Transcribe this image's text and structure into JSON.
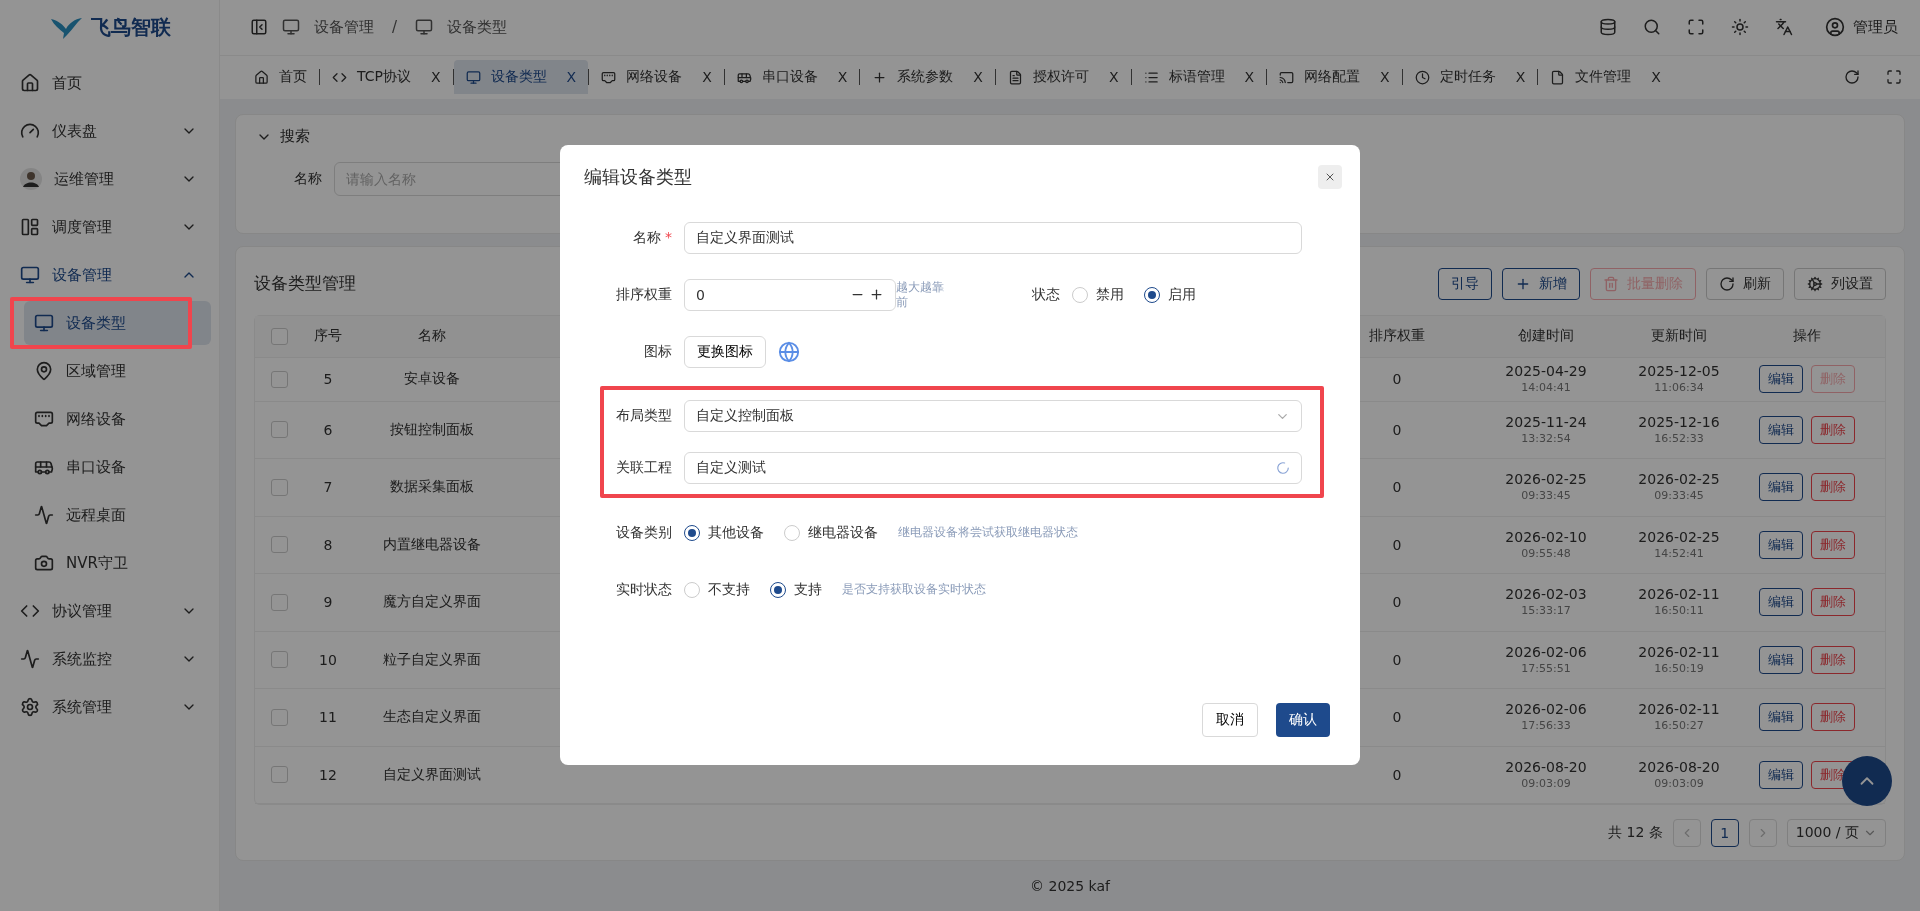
{
  "brand": {
    "name": "飞鸟智联"
  },
  "sidebar": {
    "items": [
      {
        "kind": "link",
        "label": "首页"
      },
      {
        "kind": "group",
        "label": "仪表盘",
        "expanded": false
      },
      {
        "kind": "group",
        "label": "运维管理",
        "expanded": false
      },
      {
        "kind": "group",
        "label": "调度管理",
        "expanded": false
      },
      {
        "kind": "group",
        "label": "设备管理",
        "expanded": true,
        "children": [
          {
            "label": "设备类型",
            "selected": true
          },
          {
            "label": "区域管理",
            "selected": false
          },
          {
            "label": "网络设备",
            "selected": false
          },
          {
            "label": "串口设备",
            "selected": false
          },
          {
            "label": "远程桌面",
            "selected": false
          },
          {
            "label": "NVR守卫",
            "selected": false
          }
        ]
      },
      {
        "kind": "group",
        "label": "协议管理",
        "expanded": false
      },
      {
        "kind": "group",
        "label": "系统监控",
        "expanded": false
      },
      {
        "kind": "group",
        "label": "系统管理",
        "expanded": false
      }
    ]
  },
  "header": {
    "breadcrumb": [
      "设备管理",
      "设备类型"
    ],
    "separator": "/",
    "user": "管理员"
  },
  "tabs": [
    {
      "label": "首页",
      "selected": false,
      "closable": false
    },
    {
      "label": "TCP协议",
      "selected": false,
      "closable": true,
      "close": "X"
    },
    {
      "label": "设备类型",
      "selected": true,
      "closable": true,
      "close": "X"
    },
    {
      "label": "网络设备",
      "selected": false,
      "closable": true,
      "close": "X"
    },
    {
      "label": "串口设备",
      "selected": false,
      "closable": true,
      "close": "X"
    },
    {
      "label": "系统参数",
      "selected": false,
      "closable": true,
      "close": "X"
    },
    {
      "label": "授权许可",
      "selected": false,
      "closable": true,
      "close": "X"
    },
    {
      "label": "标语管理",
      "selected": false,
      "closable": true,
      "close": "X"
    },
    {
      "label": "网络配置",
      "selected": false,
      "closable": true,
      "close": "X"
    },
    {
      "label": "定时任务",
      "selected": false,
      "closable": true,
      "close": "X"
    },
    {
      "label": "文件管理",
      "selected": false,
      "closable": true,
      "close": "X"
    }
  ],
  "search": {
    "title": "搜索",
    "expanded": true,
    "label": "名称",
    "placeholder": "请输入名称"
  },
  "table": {
    "title": "设备类型管理",
    "toolbar": [
      {
        "kind": "plain",
        "label": "引导",
        "disabled": false
      },
      {
        "kind": "add",
        "label": "新增",
        "disabled": false
      },
      {
        "kind": "delete",
        "label": "批量删除",
        "disabled": true
      },
      {
        "kind": "refresh",
        "label": "刷新",
        "disabled": false
      },
      {
        "kind": "settings",
        "label": "列设置",
        "disabled": false
      }
    ],
    "all_checked": false,
    "columns": [
      "序号",
      "名称",
      "排序权重",
      "创建时间",
      "更新时间",
      "操作"
    ],
    "rows": [
      {
        "checked": false,
        "seq": "5",
        "name": "安卓设备",
        "weight": "0",
        "created_date": "2025-04-29",
        "created_time": "14:04:41",
        "updated_date": "2025-12-05",
        "updated_time": "11:06:34",
        "edit": "编辑",
        "delete": "删除",
        "delete_disabled": true
      },
      {
        "checked": false,
        "seq": "6",
        "name": "按钮控制面板",
        "weight": "0",
        "created_date": "2025-11-24",
        "created_time": "13:32:54",
        "updated_date": "2025-12-16",
        "updated_time": "16:52:33",
        "edit": "编辑",
        "delete": "删除",
        "delete_disabled": false
      },
      {
        "checked": false,
        "seq": "7",
        "name": "数据采集面板",
        "weight": "0",
        "created_date": "2026-02-25",
        "created_time": "09:33:45",
        "updated_date": "2026-02-25",
        "updated_time": "09:33:45",
        "edit": "编辑",
        "delete": "删除",
        "delete_disabled": false
      },
      {
        "checked": false,
        "seq": "8",
        "name": "内置继电器设备",
        "weight": "0",
        "created_date": "2026-02-10",
        "created_time": "09:55:48",
        "updated_date": "2026-02-25",
        "updated_time": "14:52:41",
        "edit": "编辑",
        "delete": "删除",
        "delete_disabled": false
      },
      {
        "checked": false,
        "seq": "9",
        "name": "魔方自定义界面",
        "weight": "0",
        "created_date": "2026-02-03",
        "created_time": "15:33:17",
        "updated_date": "2026-02-11",
        "updated_time": "16:50:11",
        "edit": "编辑",
        "delete": "删除",
        "delete_disabled": false
      },
      {
        "checked": false,
        "seq": "10",
        "name": "粒子自定义界面",
        "weight": "0",
        "created_date": "2026-02-06",
        "created_time": "17:55:51",
        "updated_date": "2026-02-11",
        "updated_time": "16:50:19",
        "edit": "编辑",
        "delete": "删除",
        "delete_disabled": false
      },
      {
        "checked": false,
        "seq": "11",
        "name": "生态自定义界面",
        "weight": "0",
        "created_date": "2026-02-06",
        "created_time": "17:56:33",
        "updated_date": "2026-02-11",
        "updated_time": "16:50:27",
        "edit": "编辑",
        "delete": "删除",
        "delete_disabled": false
      },
      {
        "checked": false,
        "seq": "12",
        "name": "自定义界面测试",
        "weight": "0",
        "created_date": "2026-08-20",
        "created_time": "09:03:09",
        "updated_date": "2026-08-20",
        "updated_time": "09:03:09",
        "edit": "编辑",
        "delete": "删除",
        "delete_disabled": false
      }
    ],
    "pagination": {
      "total": "共 12 条",
      "page": "1",
      "page_size": "1000 / 页",
      "prev_disabled": true,
      "next_disabled": true
    }
  },
  "footer": "© 2025 kaf",
  "modal": {
    "title": "编辑设备类型",
    "name": {
      "label": "名称",
      "required": true,
      "required_mark": "*",
      "value": "自定义界面测试"
    },
    "weight": {
      "label": "排序权重",
      "value": "0",
      "hint": "越大越靠前"
    },
    "status": {
      "label": "状态",
      "options": [
        {
          "label": "禁用",
          "selected": false
        },
        {
          "label": "启用",
          "selected": true
        }
      ]
    },
    "icon": {
      "label": "图标",
      "button": "更换图标"
    },
    "layout": {
      "label": "布局类型",
      "value": "自定义控制面板"
    },
    "project": {
      "label": "关联工程",
      "value": "自定义测试",
      "loading": true
    },
    "category": {
      "label": "设备类别",
      "options": [
        {
          "label": "其他设备",
          "selected": true
        },
        {
          "label": "继电器设备",
          "selected": false
        }
      ],
      "hint": "继电器设备将尝试获取继电器状态"
    },
    "realtime": {
      "label": "实时状态",
      "options": [
        {
          "label": "不支持",
          "selected": false
        },
        {
          "label": "支持",
          "selected": true
        }
      ],
      "hint": "是否支持获取设备实时状态"
    },
    "cancel": "取消",
    "confirm": "确认"
  }
}
